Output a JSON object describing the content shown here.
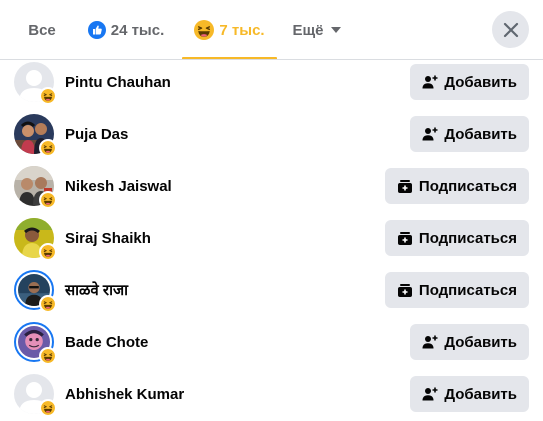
{
  "tabs": {
    "all": "Все",
    "like_count": "24 тыс.",
    "haha_count": "7 тыс.",
    "more": "Ещё"
  },
  "colors": {
    "accent": "#f7b928",
    "brand_blue": "#1877f2",
    "button_bg": "#e4e6eb",
    "muted_text": "#65676b"
  },
  "icons": {
    "like": "like-reaction-icon",
    "haha": "haha-reaction-icon",
    "more": "caret-down-icon",
    "close": "close-icon",
    "add_friend": "add-friend-icon",
    "follow": "follow-icon"
  },
  "people": [
    {
      "name": "Pintu Chauhan",
      "action": "Добавить",
      "action_type": "add"
    },
    {
      "name": "Puja Das",
      "action": "Добавить",
      "action_type": "add"
    },
    {
      "name": "Nikesh Jaiswal",
      "action": "Подписаться",
      "action_type": "follow"
    },
    {
      "name": "Siraj Shaikh",
      "action": "Подписаться",
      "action_type": "follow"
    },
    {
      "name": "साळवे राजा",
      "action": "Подписаться",
      "action_type": "follow"
    },
    {
      "name": "Bade Chote",
      "action": "Добавить",
      "action_type": "add"
    },
    {
      "name": "Abhishek Kumar",
      "action": "Добавить",
      "action_type": "add"
    }
  ]
}
